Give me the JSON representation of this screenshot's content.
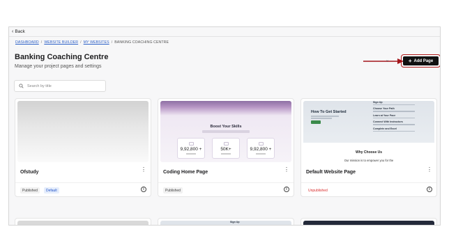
{
  "nav": {
    "back_label": "Back"
  },
  "breadcrumb": {
    "items": [
      "DASHBOARD",
      "WEBSITE BUILDER",
      "MY WEBSITES",
      "BANKING COACHING CENTRE"
    ],
    "separator": "/"
  },
  "header": {
    "title": "Banking Coaching Centre",
    "subtitle": "Manage your project pages and settings",
    "more_label": "More",
    "add_page_label": "Add Page"
  },
  "search": {
    "placeholder": "Search by title",
    "value": ""
  },
  "cards": [
    {
      "name": "Ofstudy",
      "status": "Published",
      "tag": "Default"
    },
    {
      "name": "Coding Home Page",
      "status": "Published",
      "tag": ""
    },
    {
      "name": "Default Website Page",
      "status": "Unpublished",
      "tag": ""
    }
  ],
  "thumbnails": {
    "coding": {
      "title": "Boost Your Skills",
      "stats": [
        "9,92,800 +",
        "50K+",
        "9,92,800 +"
      ]
    },
    "website": {
      "hero_title": "How To Get Started",
      "steps": [
        "Sign Up",
        "Choose Your Path",
        "Learn at Your Pace",
        "Connect With Instructors",
        "Complete and Excel"
      ],
      "section_title": "Why Choose Us",
      "section_text": "Our mission is to empower you for the"
    }
  },
  "bottom_steps": [
    "Sign Up"
  ],
  "colors": {
    "accent": "#111111",
    "highlight_border": "#b01818",
    "arrow": "#a3151b",
    "link": "#2b5fc7",
    "unpublished": "#d92c2c",
    "default_badge": "#2456c8"
  }
}
